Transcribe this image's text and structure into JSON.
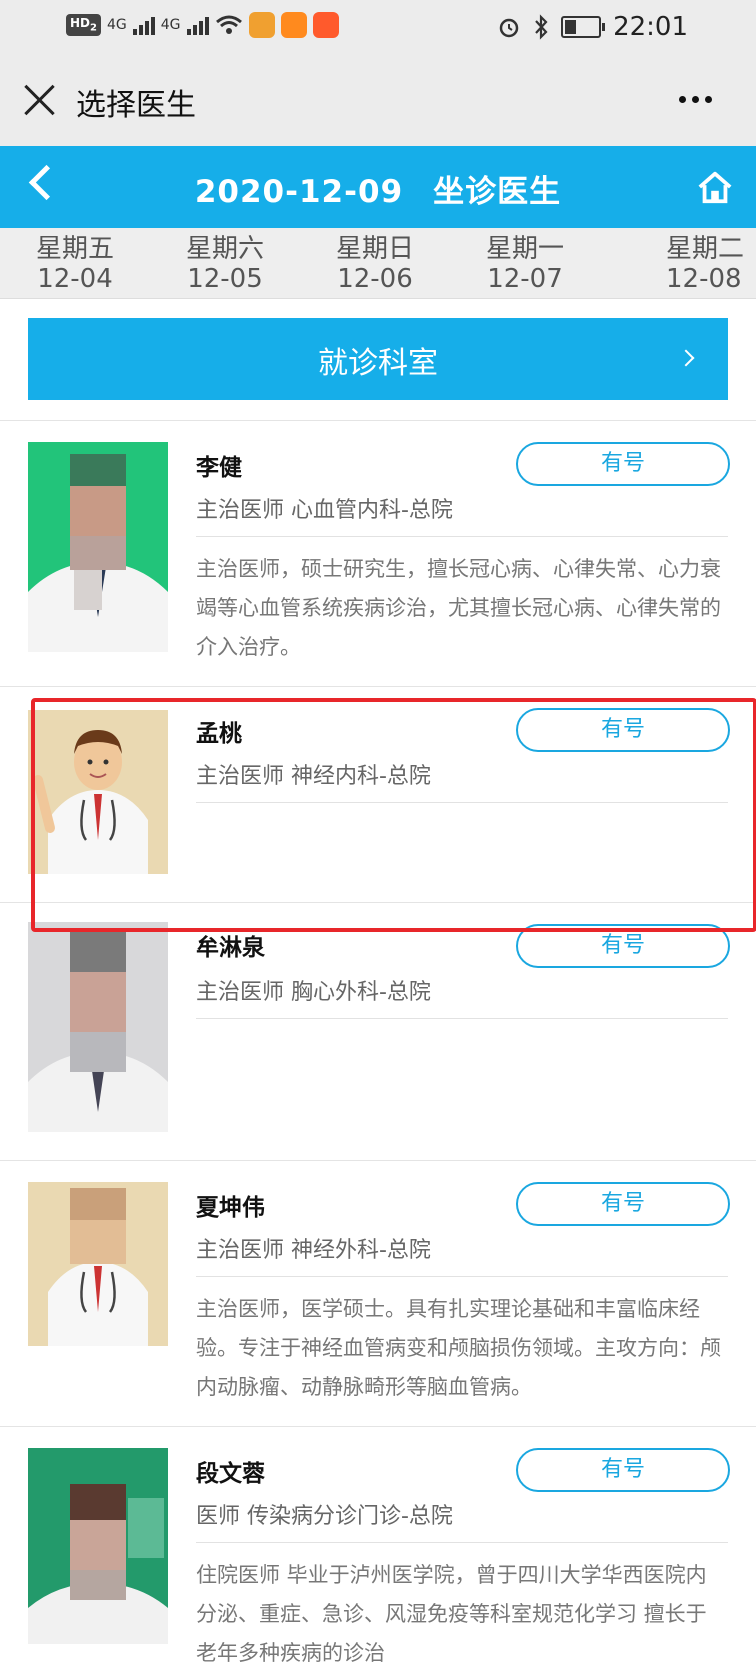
{
  "status_bar": {
    "badge": "HD",
    "badge_sub": "2",
    "net1": "4G",
    "net2": "4G",
    "time": "22:01"
  },
  "window": {
    "title": "选择医生"
  },
  "header": {
    "date": "2020-12-09",
    "title": "坐诊医生"
  },
  "week": [
    {
      "day": "星期五",
      "date": "12-04"
    },
    {
      "day": "星期六",
      "date": "12-05"
    },
    {
      "day": "星期日",
      "date": "12-06"
    },
    {
      "day": "星期一",
      "date": "12-07"
    },
    {
      "day": "星期二",
      "date": "12-08"
    }
  ],
  "department_button": {
    "label": "就诊科室"
  },
  "doctors": [
    {
      "name": "李健",
      "title": "主治医师 心血管内科-总院",
      "status": "有号",
      "description": "主治医师，硕士研究生，擅长冠心病、心律失常、心力衰竭等心血管系统疾病诊治，尤其擅长冠心病、心律失常的介入治疗。"
    },
    {
      "name": "孟桃",
      "title": "主治医师 神经内科-总院",
      "status": "有号",
      "description": ""
    },
    {
      "name": "牟淋泉",
      "title": "主治医师 胸心外科-总院",
      "status": "有号",
      "description": ""
    },
    {
      "name": "夏坤伟",
      "title": "主治医师 神经外科-总院",
      "status": "有号",
      "description": "主治医师，医学硕士。具有扎实理论基础和丰富临床经验。专注于神经血管病变和颅脑损伤领域。主攻方向：颅内动脉瘤、动静脉畸形等脑血管病。"
    },
    {
      "name": "段文蓉",
      "title": "医师 传染病分诊门诊-总院",
      "status": "有号",
      "description": "住院医师 毕业于泸州医学院，曾于四川大学华西医院内分泌、重症、急诊、风湿免疫等科室规范化学习 擅长于老年多种疾病的诊治"
    }
  ],
  "colors": {
    "primary": "#16aee9",
    "highlight": "#e8262a",
    "chrome": "#ececec"
  }
}
